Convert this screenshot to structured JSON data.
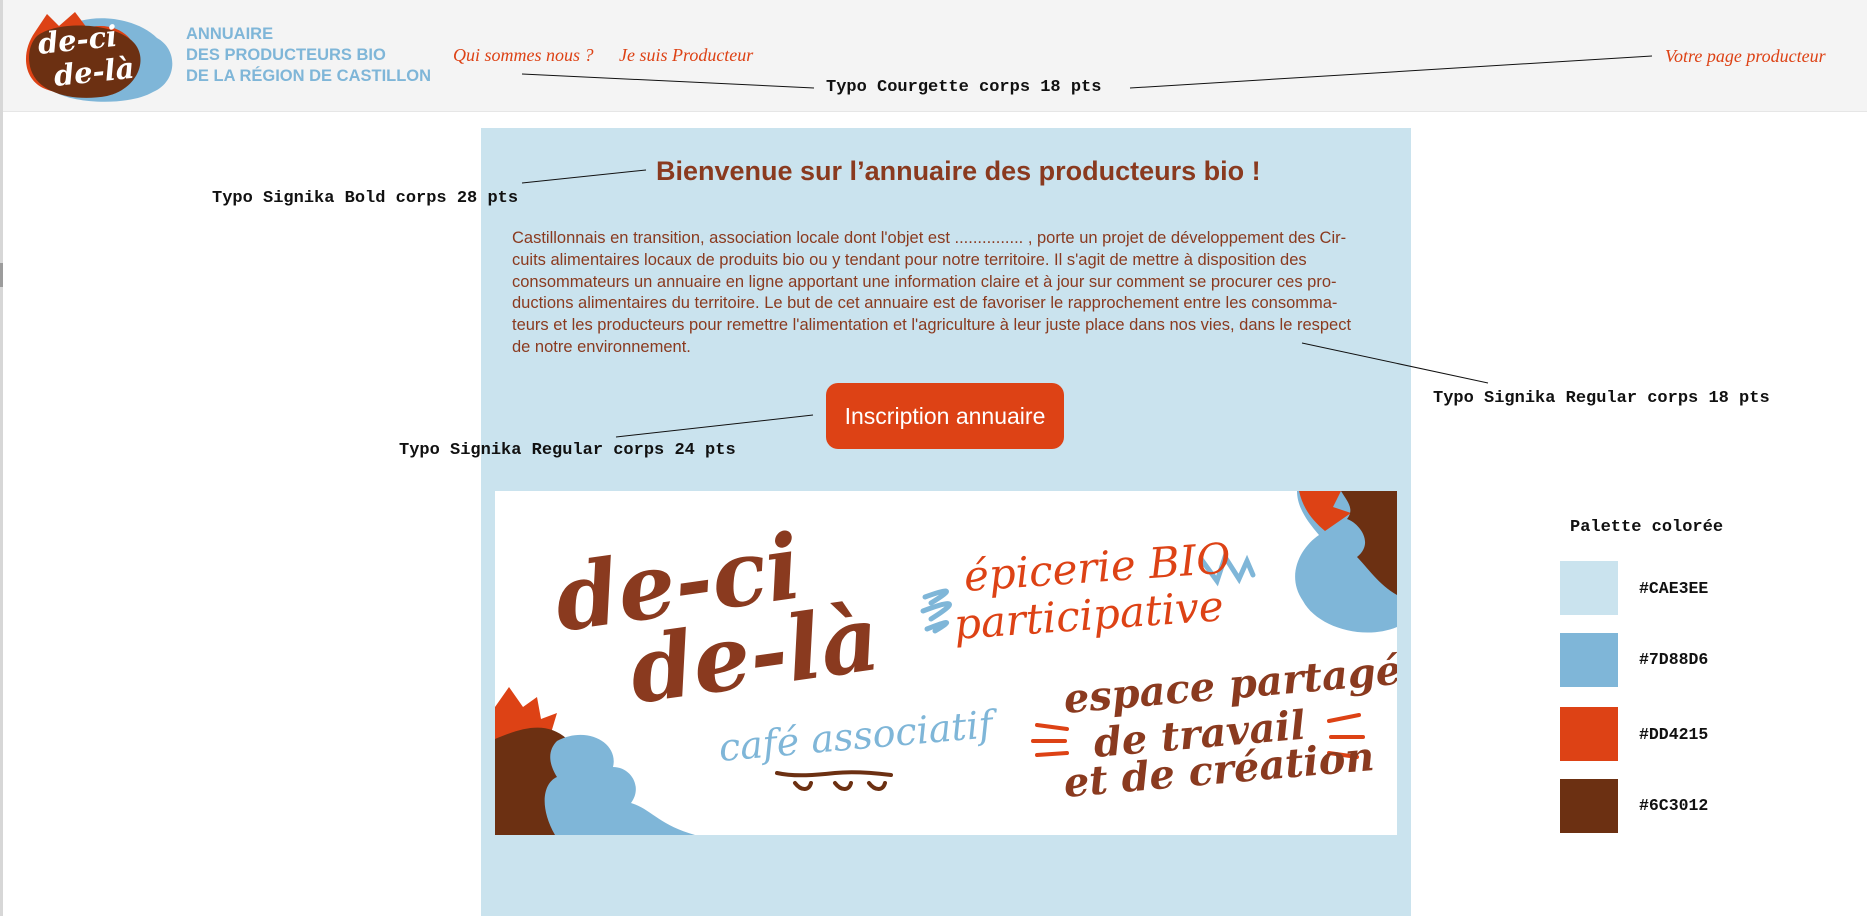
{
  "header": {
    "logo_text": [
      "de-ci",
      "de-là"
    ],
    "brand_lines": [
      "ANNUAIRE",
      "DES PRODUCTEURS BIO",
      "DE LA RÉGION DE CASTILLON"
    ],
    "nav": {
      "about": "Qui sommes nous ?",
      "producer": "Je suis Producteur",
      "producer_page": "Votre page producteur"
    }
  },
  "annotations": {
    "nav_typo": "Typo Courgette corps 18 pts",
    "title_typo": "Typo Signika Bold corps 28 pts",
    "body_typo": "Typo Signika Regular corps 18 pts",
    "button_typo": "Typo Signika Regular corps 24 pts"
  },
  "main": {
    "title": "Bienvenue sur l’annuaire des producteurs bio !",
    "intro_lines": [
      "Castillonnais en transition, association locale dont l'objet est ............... , porte un projet de développement des Cir-",
      "cuits alimentaires locaux de produits bio ou y tendant pour notre territoire. Il s'agit de mettre à disposition des",
      "consommateurs un annuaire en ligne apportant une information claire et à jour sur comment se procurer ces pro-",
      "ductions alimentaires du territoire. Le but de cet annuaire est de favoriser le rapprochement entre les consomma-",
      "teurs et les producteurs pour remettre l'alimentation et l'agriculture à leur juste place dans nos vies, dans le respect",
      "de notre environnement."
    ],
    "cta_label": "Inscription annuaire",
    "banner": {
      "logo_lines": [
        "de-ci",
        "de-là"
      ],
      "epicerie_lines": [
        "épicerie BIO",
        "participative"
      ],
      "cafe": "café associatif",
      "espace_lines": [
        "espace partagé",
        "de travail",
        "et de création"
      ]
    }
  },
  "palette": {
    "title": "Palette colorée",
    "swatches": [
      {
        "label": "#CAE3EE",
        "color": "#CAE3EE"
      },
      {
        "label": "#7D88D6",
        "color": "#7FB6D8"
      },
      {
        "label": "#DD4215",
        "color": "#DD4215"
      },
      {
        "label": "#6C3012",
        "color": "#6C3012"
      }
    ]
  }
}
